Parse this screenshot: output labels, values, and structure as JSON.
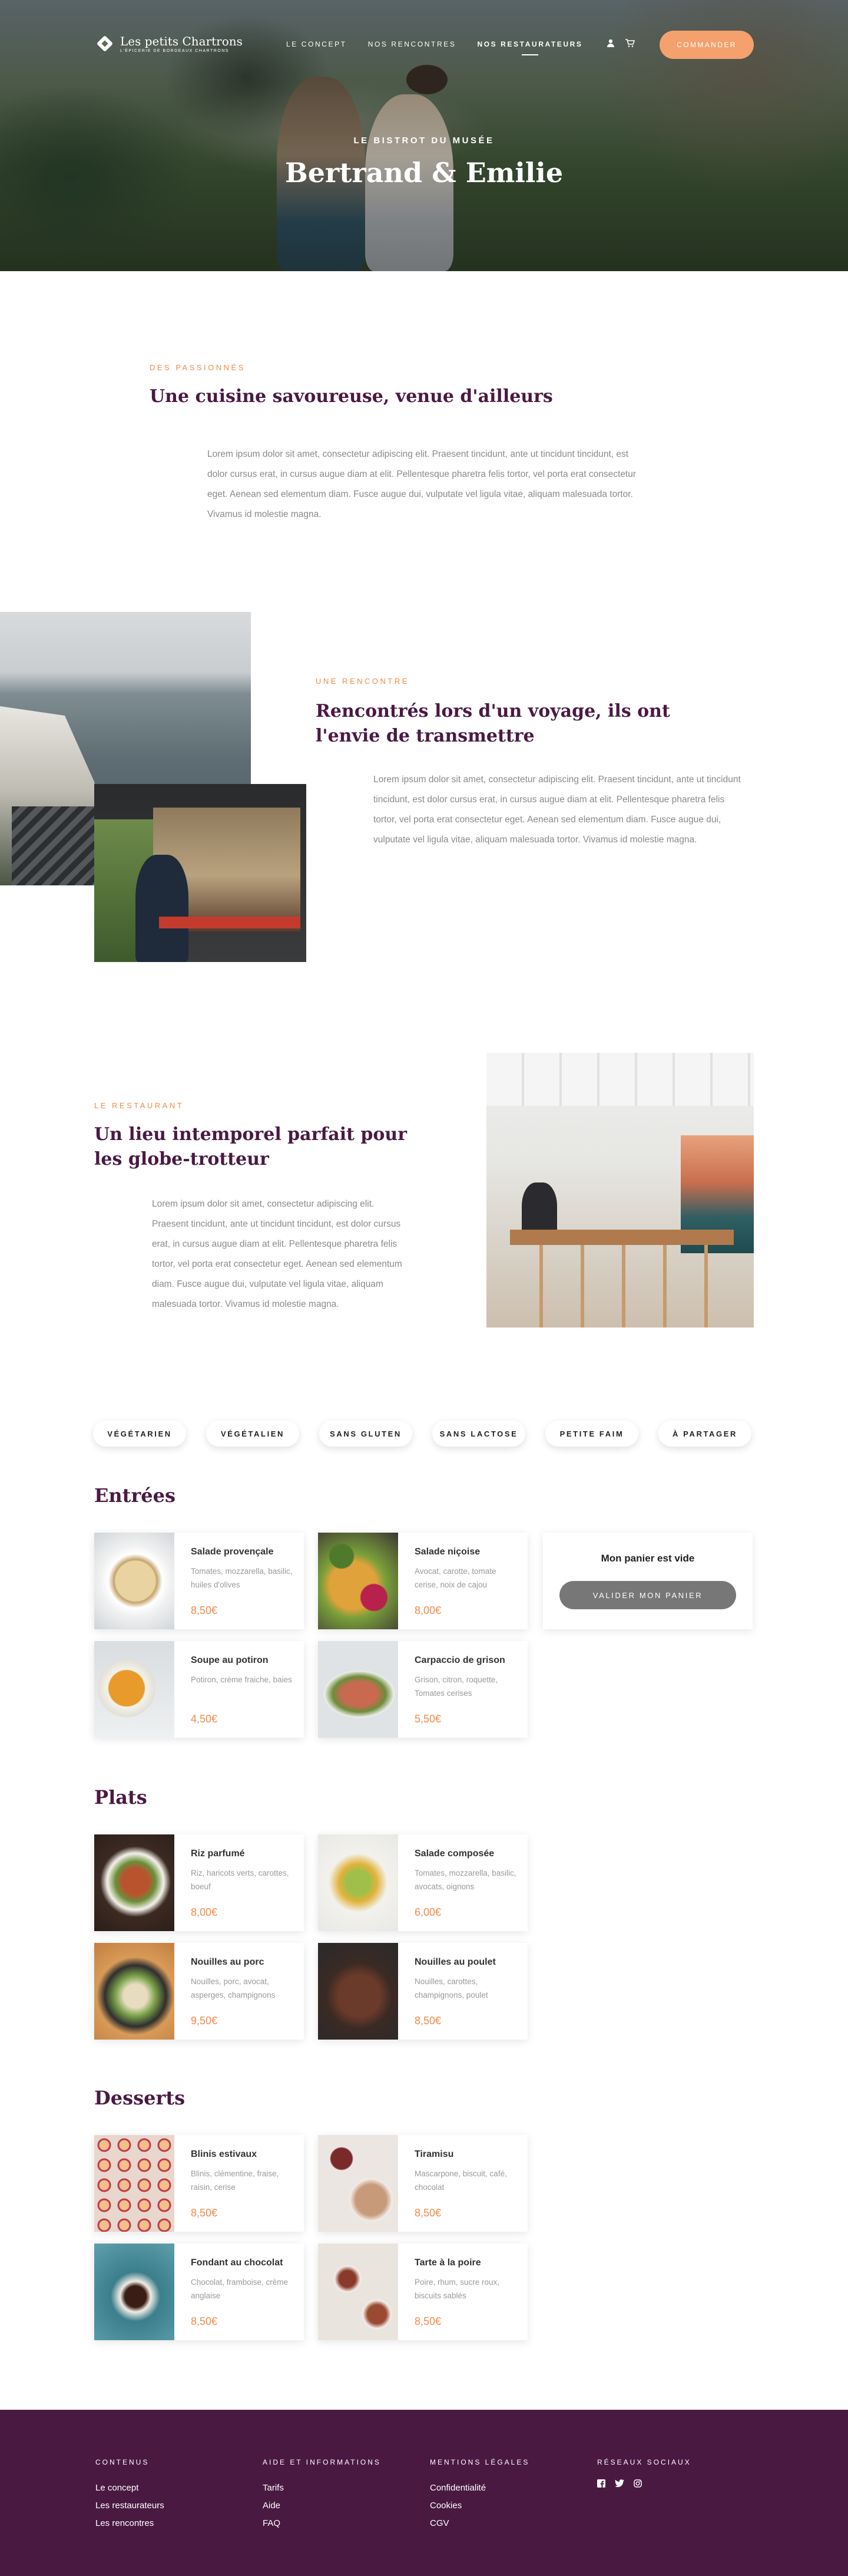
{
  "nav": {
    "logo_name": "Les petits Chartrons",
    "logo_tagline": "L'épicerie de Bordeaux Chartrons",
    "links": [
      "Le concept",
      "Nos rencontres",
      "Nos restaurateurs"
    ],
    "user_icon": "user-icon",
    "cart_icon": "cart-icon",
    "order_button": "Commander"
  },
  "hero": {
    "kicker": "Le Bistrot du Musée",
    "title": "Bertrand & Emilie"
  },
  "section1": {
    "kicker": "Des passionnés",
    "title": "Une cuisine savoureuse, venue d'ailleurs",
    "text": "Lorem ipsum dolor sit amet, consectetur adipiscing elit. Praesent tincidunt, ante ut tincidunt tincidunt, est dolor cursus erat, in cursus augue diam at elit. Pellentesque pharetra felis tortor, vel porta erat consectetur eget. Aenean sed elementum diam. Fusce augue dui, vulputate vel ligula vitae, aliquam malesuada tortor. Vivamus id molestie magna."
  },
  "section2": {
    "kicker": "Une rencontre",
    "title": "Rencontrés lors d'un voyage, ils ont l'envie de transmettre",
    "text": "Lorem ipsum dolor sit amet, consectetur adipiscing elit. Praesent tincidunt, ante ut tincidunt tincidunt, est dolor cursus erat, in cursus augue diam at elit. Pellentesque pharetra felis tortor, vel porta erat consectetur eget. Aenean sed elementum diam. Fusce augue dui, vulputate vel ligula vitae, aliquam malesuada tortor. Vivamus id molestie magna."
  },
  "section3": {
    "kicker": "Le restaurant",
    "title": "Un lieu intemporel parfait pour les globe-trotteur",
    "text": "Lorem ipsum dolor sit amet, consectetur adipiscing elit. Praesent tincidunt, ante ut tincidunt tincidunt, est dolor cursus erat, in cursus augue diam at elit. Pellentesque pharetra felis tortor, vel porta erat consectetur eget. Aenean sed elementum diam. Fusce augue dui, vulputate vel ligula vitae, aliquam malesuada tortor. Vivamus id molestie magna."
  },
  "filters": [
    "Végétarien",
    "Végétalien",
    "Sans gluten",
    "Sans lactose",
    "Petite faim",
    "À partager"
  ],
  "menu": {
    "entrees": {
      "title": "Entrées",
      "items": [
        {
          "name": "Salade provençale",
          "desc": "Tomates, mozzarella, basilic, huiles d'olives",
          "price": "8,50€"
        },
        {
          "name": "Salade niçoise",
          "desc": "Avocat, carotte, tomate cerise, noix de cajou",
          "price": "8,00€"
        },
        {
          "name": "Soupe au potiron",
          "desc": "Potiron, crème fraiche, baies",
          "price": "4,50€"
        },
        {
          "name": "Carpaccio de grison",
          "desc": "Grison, citron, roquette, Tomates cerises",
          "price": "5,50€"
        }
      ]
    },
    "plats": {
      "title": "Plats",
      "items": [
        {
          "name": "Riz parfumé",
          "desc": "Riz, haricots verts, carottes, boeuf",
          "price": "8,00€"
        },
        {
          "name": "Salade composée",
          "desc": "Tomates, mozzarella, basilic, avocats, oignons",
          "price": "6,00€"
        },
        {
          "name": "Nouilles au porc",
          "desc": "Nouilles, porc, avocat, asperges, champignons",
          "price": "9,50€"
        },
        {
          "name": "Nouilles au poulet",
          "desc": "Nouilles, carottes, champignons, poulet",
          "price": "8,50€"
        }
      ]
    },
    "desserts": {
      "title": "Desserts",
      "items": [
        {
          "name": "Blinis estivaux",
          "desc": "Blinis, clémentine, fraise, raisin, cerise",
          "price": "8,50€"
        },
        {
          "name": "Tiramisu",
          "desc": "Mascarpone, biscuit, café, chocolat",
          "price": "8,50€"
        },
        {
          "name": "Fondant au chocolat",
          "desc": "Chocolat, framboise, crème anglaise",
          "price": "8,50€"
        },
        {
          "name": "Tarte à la poire",
          "desc": "Poire, rhum, sucre roux, biscuits sablés",
          "price": "8,50€"
        }
      ]
    }
  },
  "cart": {
    "title": "Mon panier est vide",
    "button": "Valider mon panier"
  },
  "footer": {
    "columns": [
      {
        "title": "Contenus",
        "links": [
          "Le concept",
          "Les restaurateurs",
          "Les rencontres"
        ]
      },
      {
        "title": "Aide et informations",
        "links": [
          "Tarifs",
          "Aide",
          "FAQ"
        ]
      },
      {
        "title": "Mentions légales",
        "links": [
          "Confidentialité",
          "Cookies",
          "CGV"
        ]
      },
      {
        "title": "Réseaux sociaux",
        "links": []
      }
    ],
    "social_icons": [
      "facebook-icon",
      "twitter-icon",
      "instagram-icon"
    ]
  },
  "colors": {
    "accent": "#f08a4b",
    "button": "#f4a16d",
    "brand": "#4a1942"
  }
}
